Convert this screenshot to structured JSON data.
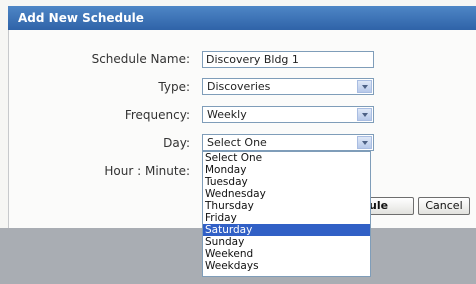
{
  "dialog": {
    "title": "Add New Schedule"
  },
  "form": {
    "schedule_name": {
      "label": "Schedule Name:",
      "value": "Discovery Bldg 1"
    },
    "type": {
      "label": "Type:",
      "value": "Discoveries"
    },
    "frequency": {
      "label": "Frequency:",
      "value": "Weekly"
    },
    "day": {
      "label": "Day:",
      "value": "Select One",
      "options": [
        "Select One",
        "Monday",
        "Tuesday",
        "Wednesday",
        "Thursday",
        "Friday",
        "Saturday",
        "Sunday",
        "Weekend",
        "Weekdays"
      ],
      "highlighted": "Saturday"
    },
    "time": {
      "label": "Hour : Minute:"
    }
  },
  "buttons": {
    "schedule": "ule",
    "cancel": "Cancel"
  },
  "colors": {
    "title_bar": "#3a70b5",
    "selection": "#3160c6",
    "footer": "#a9adb3"
  }
}
